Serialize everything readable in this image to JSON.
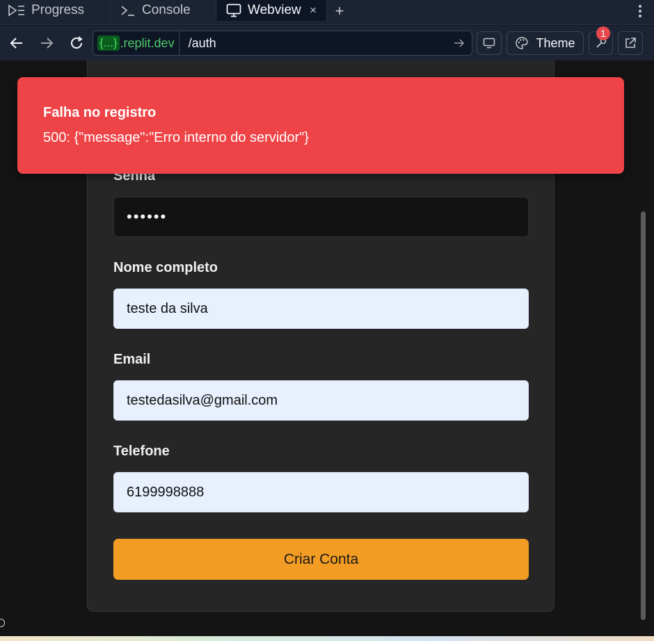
{
  "tabs": [
    {
      "label": "Progress",
      "icon": "progress-icon"
    },
    {
      "label": "Console",
      "icon": "terminal-icon"
    },
    {
      "label": "Webview",
      "icon": "monitor-icon",
      "active": true
    }
  ],
  "tab_close": "×",
  "tab_add": "+",
  "url": {
    "badge": "{...}",
    "domain": ".replit.dev",
    "path": "/auth"
  },
  "toolbar": {
    "theme_label": "Theme",
    "notification_count": "1"
  },
  "toast": {
    "title": "Falha no registro",
    "message": "500: {\"message\":\"Erro interno do servidor\"}"
  },
  "form": {
    "password_label": "Senha",
    "password_value": "••••••",
    "name_label": "Nome completo",
    "name_value": "teste da silva",
    "email_label": "Email",
    "email_value": "testedasilva@gmail.com",
    "phone_label": "Telefone",
    "phone_value": "6199998888",
    "submit_label": "Criar Conta"
  },
  "colors": {
    "toast": "#ef4447",
    "submit": "#f39c24",
    "domain": "#4ec86a"
  }
}
